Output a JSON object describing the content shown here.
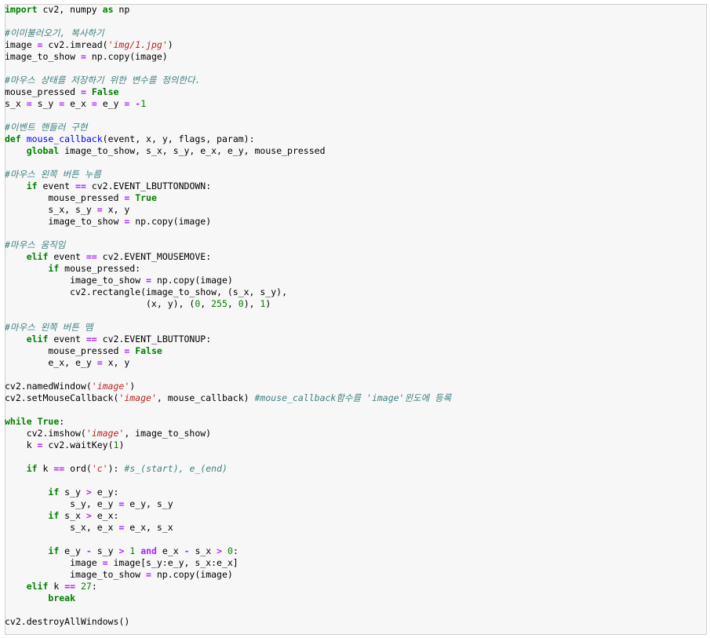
{
  "colors": {
    "keyword": "#008000",
    "operator": "#aa22ff",
    "number": "#008000",
    "string": "#ba2121",
    "comment": "#408080",
    "function_name": "#0000ff",
    "background": "#f7f7f7",
    "border": "#cfcfcf"
  },
  "code_lines": [
    [
      [
        "kw",
        "import"
      ],
      [
        "tx",
        " cv2, numpy "
      ],
      [
        "kw",
        "as"
      ],
      [
        "tx",
        " np"
      ]
    ],
    [],
    [
      [
        "cm",
        "#이미불러오기, 복사하기"
      ]
    ],
    [
      [
        "tx",
        "image "
      ],
      [
        "op",
        "="
      ],
      [
        "tx",
        " cv2.imread("
      ],
      [
        "str",
        "'img/1.jpg'"
      ],
      [
        "tx",
        ")"
      ]
    ],
    [
      [
        "tx",
        "image_to_show "
      ],
      [
        "op",
        "="
      ],
      [
        "tx",
        " np.copy(image)"
      ]
    ],
    [],
    [
      [
        "cm",
        "#마우스 상태를 저장하기 위한 변수를 정의한다."
      ]
    ],
    [
      [
        "tx",
        "mouse_pressed "
      ],
      [
        "op",
        "="
      ],
      [
        "tx",
        " "
      ],
      [
        "kw",
        "False"
      ]
    ],
    [
      [
        "tx",
        "s_x "
      ],
      [
        "op",
        "="
      ],
      [
        "tx",
        " s_y "
      ],
      [
        "op",
        "="
      ],
      [
        "tx",
        " e_x "
      ],
      [
        "op",
        "="
      ],
      [
        "tx",
        " e_y "
      ],
      [
        "op",
        "="
      ],
      [
        "tx",
        " "
      ],
      [
        "op",
        "-"
      ],
      [
        "num",
        "1"
      ]
    ],
    [],
    [
      [
        "cm",
        "#이벤트 핸들러 구현"
      ]
    ],
    [
      [
        "kw",
        "def"
      ],
      [
        "tx",
        " "
      ],
      [
        "fn",
        "mouse_callback"
      ],
      [
        "tx",
        "(event, x, y, flags, param):"
      ]
    ],
    [
      [
        "tx",
        "    "
      ],
      [
        "kw",
        "global"
      ],
      [
        "tx",
        " image_to_show, s_x, s_y, e_x, e_y, mouse_pressed"
      ]
    ],
    [],
    [
      [
        "cm",
        "#마우스 왼쪽 버튼 누름"
      ]
    ],
    [
      [
        "tx",
        "    "
      ],
      [
        "kw",
        "if"
      ],
      [
        "tx",
        " event "
      ],
      [
        "op",
        "=="
      ],
      [
        "tx",
        " cv2.EVENT_LBUTTONDOWN:"
      ]
    ],
    [
      [
        "tx",
        "        mouse_pressed "
      ],
      [
        "op",
        "="
      ],
      [
        "tx",
        " "
      ],
      [
        "kw",
        "True"
      ]
    ],
    [
      [
        "tx",
        "        s_x, s_y "
      ],
      [
        "op",
        "="
      ],
      [
        "tx",
        " x, y"
      ]
    ],
    [
      [
        "tx",
        "        image_to_show "
      ],
      [
        "op",
        "="
      ],
      [
        "tx",
        " np.copy(image)"
      ]
    ],
    [],
    [
      [
        "cm",
        "#마우스 움직임"
      ]
    ],
    [
      [
        "tx",
        "    "
      ],
      [
        "kw",
        "elif"
      ],
      [
        "tx",
        " event "
      ],
      [
        "op",
        "=="
      ],
      [
        "tx",
        " cv2.EVENT_MOUSEMOVE:"
      ]
    ],
    [
      [
        "tx",
        "        "
      ],
      [
        "kw",
        "if"
      ],
      [
        "tx",
        " mouse_pressed:"
      ]
    ],
    [
      [
        "tx",
        "            image_to_show "
      ],
      [
        "op",
        "="
      ],
      [
        "tx",
        " np.copy(image)"
      ]
    ],
    [
      [
        "tx",
        "            cv2.rectangle(image_to_show, (s_x, s_y),"
      ]
    ],
    [
      [
        "tx",
        "                          (x, y), ("
      ],
      [
        "num",
        "0"
      ],
      [
        "tx",
        ", "
      ],
      [
        "num",
        "255"
      ],
      [
        "tx",
        ", "
      ],
      [
        "num",
        "0"
      ],
      [
        "tx",
        "), "
      ],
      [
        "num",
        "1"
      ],
      [
        "tx",
        ")"
      ]
    ],
    [],
    [
      [
        "cm",
        "#마우스 왼쪽 버튼 뗌"
      ]
    ],
    [
      [
        "tx",
        "    "
      ],
      [
        "kw",
        "elif"
      ],
      [
        "tx",
        " event "
      ],
      [
        "op",
        "=="
      ],
      [
        "tx",
        " cv2.EVENT_LBUTTONUP:"
      ]
    ],
    [
      [
        "tx",
        "        mouse_pressed "
      ],
      [
        "op",
        "="
      ],
      [
        "tx",
        " "
      ],
      [
        "kw",
        "False"
      ]
    ],
    [
      [
        "tx",
        "        e_x, e_y "
      ],
      [
        "op",
        "="
      ],
      [
        "tx",
        " x, y"
      ]
    ],
    [],
    [
      [
        "tx",
        "cv2.namedWindow("
      ],
      [
        "str",
        "'image'"
      ],
      [
        "tx",
        ")"
      ]
    ],
    [
      [
        "tx",
        "cv2.setMouseCallback("
      ],
      [
        "str",
        "'image'"
      ],
      [
        "tx",
        ", mouse_callback) "
      ],
      [
        "cm",
        "#mouse_callback함수를 'image'윈도에 등록"
      ]
    ],
    [],
    [
      [
        "kw",
        "while"
      ],
      [
        "tx",
        " "
      ],
      [
        "kw",
        "True"
      ],
      [
        "tx",
        ":"
      ]
    ],
    [
      [
        "tx",
        "    cv2.imshow("
      ],
      [
        "str",
        "'image'"
      ],
      [
        "tx",
        ", image_to_show)"
      ]
    ],
    [
      [
        "tx",
        "    k "
      ],
      [
        "op",
        "="
      ],
      [
        "tx",
        " cv2.waitKey("
      ],
      [
        "num",
        "1"
      ],
      [
        "tx",
        ")"
      ]
    ],
    [],
    [
      [
        "tx",
        "    "
      ],
      [
        "kw",
        "if"
      ],
      [
        "tx",
        " k "
      ],
      [
        "op",
        "=="
      ],
      [
        "tx",
        " ord("
      ],
      [
        "str",
        "'c'"
      ],
      [
        "tx",
        "): "
      ],
      [
        "cm",
        "#s_(start), e_(end)"
      ]
    ],
    [],
    [
      [
        "tx",
        "        "
      ],
      [
        "kw",
        "if"
      ],
      [
        "tx",
        " s_y "
      ],
      [
        "op",
        ">"
      ],
      [
        "tx",
        " e_y:"
      ]
    ],
    [
      [
        "tx",
        "            s_y, e_y "
      ],
      [
        "op",
        "="
      ],
      [
        "tx",
        " e_y, s_y"
      ]
    ],
    [
      [
        "tx",
        "        "
      ],
      [
        "kw",
        "if"
      ],
      [
        "tx",
        " s_x "
      ],
      [
        "op",
        ">"
      ],
      [
        "tx",
        " e_x:"
      ]
    ],
    [
      [
        "tx",
        "            s_x, e_x "
      ],
      [
        "op",
        "="
      ],
      [
        "tx",
        " e_x, s_x"
      ]
    ],
    [],
    [
      [
        "tx",
        "        "
      ],
      [
        "kw",
        "if"
      ],
      [
        "tx",
        " e_y "
      ],
      [
        "op",
        "-"
      ],
      [
        "tx",
        " s_y "
      ],
      [
        "op",
        ">"
      ],
      [
        "tx",
        " "
      ],
      [
        "num",
        "1"
      ],
      [
        "tx",
        " "
      ],
      [
        "op",
        "and"
      ],
      [
        "tx",
        " e_x "
      ],
      [
        "op",
        "-"
      ],
      [
        "tx",
        " s_x "
      ],
      [
        "op",
        ">"
      ],
      [
        "tx",
        " "
      ],
      [
        "num",
        "0"
      ],
      [
        "tx",
        ":"
      ]
    ],
    [
      [
        "tx",
        "            image "
      ],
      [
        "op",
        "="
      ],
      [
        "tx",
        " image[s_y:e_y, s_x:e_x]"
      ]
    ],
    [
      [
        "tx",
        "            image_to_show "
      ],
      [
        "op",
        "="
      ],
      [
        "tx",
        " np.copy(image)"
      ]
    ],
    [
      [
        "tx",
        "    "
      ],
      [
        "kw",
        "elif"
      ],
      [
        "tx",
        " k "
      ],
      [
        "op",
        "=="
      ],
      [
        "tx",
        " "
      ],
      [
        "num",
        "27"
      ],
      [
        "tx",
        ":"
      ]
    ],
    [
      [
        "tx",
        "        "
      ],
      [
        "kw",
        "break"
      ]
    ],
    [],
    [
      [
        "tx",
        "cv2.destroyAllWindows()"
      ]
    ]
  ]
}
